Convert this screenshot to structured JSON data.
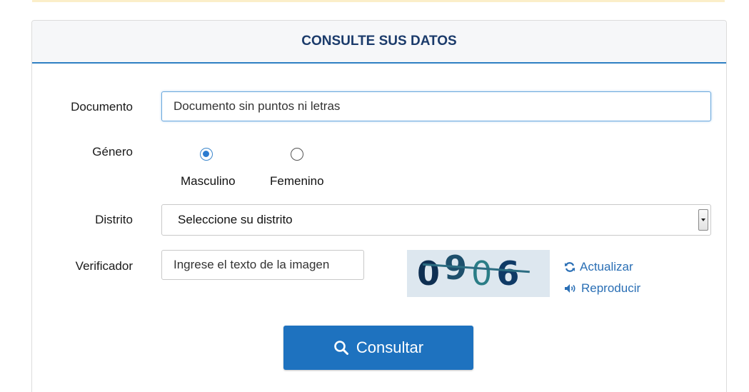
{
  "panel": {
    "title": "CONSULTE SUS DATOS"
  },
  "documento": {
    "label": "Documento",
    "placeholder": "Documento sin puntos ni letras"
  },
  "genero": {
    "label": "Género",
    "options": [
      {
        "label": "Masculino",
        "checked": true
      },
      {
        "label": "Femenino",
        "checked": false
      }
    ]
  },
  "distrito": {
    "label": "Distrito",
    "selected": "Seleccione su distrito"
  },
  "verificador": {
    "label": "Verificador",
    "placeholder": "Ingrese el texto de la imagen",
    "captcha_chars": [
      "0",
      "9",
      "0",
      "6"
    ],
    "refresh_label": "Actualizar",
    "audio_label": "Reproducir"
  },
  "submit": {
    "label": "Consultar"
  },
  "colors": {
    "accent": "#1e72bf",
    "header_text": "#1b3b6b",
    "link": "#2a6fb5",
    "banner": "#fbeec9"
  }
}
